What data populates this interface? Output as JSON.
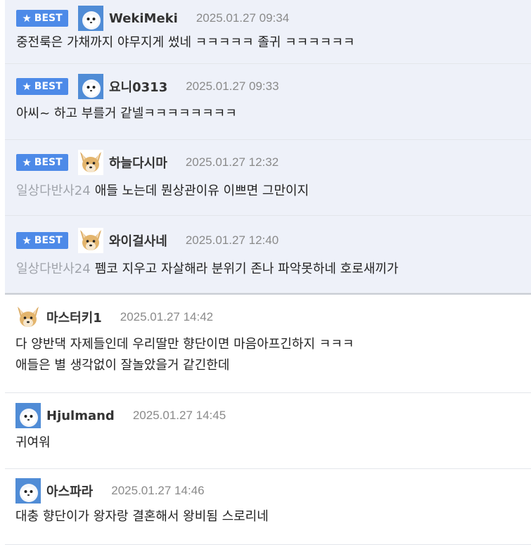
{
  "badge_label": "BEST",
  "comments": [
    {
      "nick": "WekiMeki",
      "time": "2025.01.27 09:34",
      "tag": "",
      "lines": [
        "중전룩은 가채까지 야무지게 썼네 ㅋㅋㅋㅋㅋ 졸귀 ㅋㅋㅋㅋㅋㅋ"
      ],
      "avatar": "seal-icon",
      "best": true
    },
    {
      "nick": "요니0313",
      "time": "2025.01.27 09:33",
      "tag": "",
      "lines": [
        "아씨~ 하고 부를거 같넬ㅋㅋㅋㅋㅋㅋㅋㅋ"
      ],
      "avatar": "seal-icon",
      "best": true
    },
    {
      "nick": "하늘다시마",
      "time": "2025.01.27 12:32",
      "tag": "일상다반사24",
      "lines": [
        "애들 노는데 뭔상관이유 이쁘면 그만이지"
      ],
      "avatar": "dog-icon",
      "best": true
    },
    {
      "nick": "와이걸사네",
      "time": "2025.01.27 12:40",
      "tag": "일상다반사24",
      "lines": [
        "펨코 지우고 자살해라 분위기 존나 파악못하네 호로새끼가"
      ],
      "avatar": "dog-icon",
      "best": true
    },
    {
      "nick": "마스터키1",
      "time": "2025.01.27 14:42",
      "tag": "",
      "lines": [
        "다 양반댁 자제들인데 우리딸만 향단이면 마음아프긴하지 ㅋㅋㅋ",
        "애들은 별 생각없이 잘놀았을거 같긴한데"
      ],
      "avatar": "dog-icon",
      "best": false
    },
    {
      "nick": "Hjulmand",
      "time": "2025.01.27 14:45",
      "tag": "",
      "lines": [
        "귀여워"
      ],
      "avatar": "seal-icon",
      "best": false
    },
    {
      "nick": "아스파라",
      "time": "2025.01.27 14:46",
      "tag": "",
      "lines": [
        "대충 향단이가 왕자랑 결혼해서 왕비됨 스로리네"
      ],
      "avatar": "seal-icon",
      "best": false
    }
  ]
}
